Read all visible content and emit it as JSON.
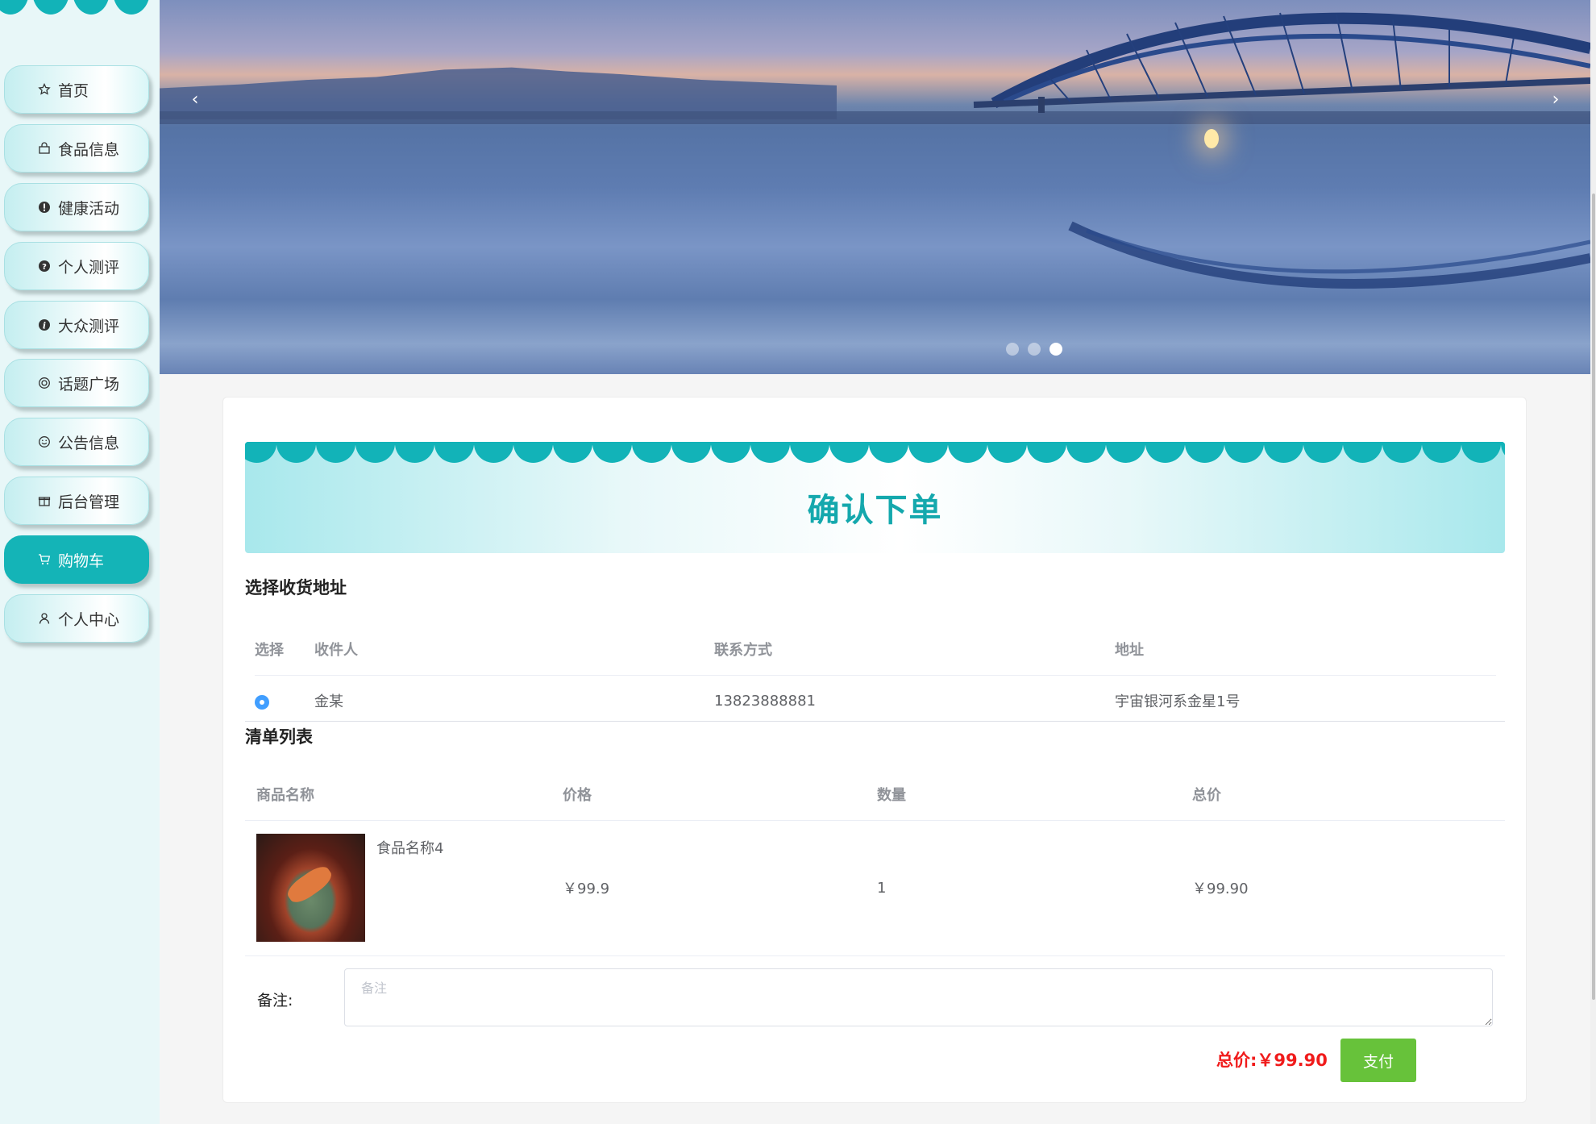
{
  "sidebar": {
    "items": [
      {
        "label": "首页",
        "icon": "star-icon"
      },
      {
        "label": "食品信息",
        "icon": "bag-icon"
      },
      {
        "label": "健康活动",
        "icon": "alert-icon"
      },
      {
        "label": "个人测评",
        "icon": "question-icon"
      },
      {
        "label": "大众测评",
        "icon": "info-icon"
      },
      {
        "label": "话题广场",
        "icon": "chat-icon"
      },
      {
        "label": "公告信息",
        "icon": "smile-icon"
      },
      {
        "label": "后台管理",
        "icon": "gift-icon"
      },
      {
        "label": "购物车",
        "icon": "cart-icon",
        "active": true
      },
      {
        "label": "个人中心",
        "icon": "user-icon"
      }
    ]
  },
  "banner": {
    "prev": "‹",
    "next": "›",
    "active_dot": 3,
    "dot_count": 3
  },
  "order": {
    "title": "确认下单",
    "address_section": "选择收货地址",
    "address_headers": [
      "选择",
      "收件人",
      "联系方式",
      "地址"
    ],
    "address_row": {
      "recipient": "金某",
      "phone": "13823888881",
      "address": "宇宙银河系金星1号",
      "selected": true
    },
    "list_section": "清单列表",
    "list_headers": [
      "商品名称",
      "价格",
      "数量",
      "总价"
    ],
    "item": {
      "name": "食品名称4",
      "price": "￥99.9",
      "qty": "1",
      "subtotal": "￥99.90"
    },
    "remark_label": "备注:",
    "remark_placeholder": "备注",
    "total_label": "总价:",
    "total_value": "￥99.90",
    "pay_label": "支付"
  },
  "colors": {
    "accent": "#14b4b7",
    "title": "#14a8ad",
    "pay": "#67c23a",
    "total": "#f01b1b",
    "radio": "#409eff"
  }
}
